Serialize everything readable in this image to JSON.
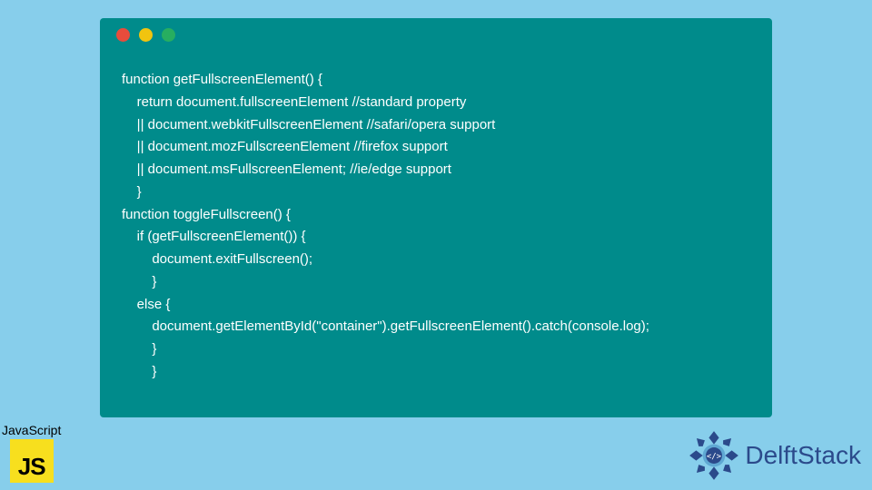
{
  "code": {
    "lines": [
      "function getFullscreenElement() {",
      "    return document.fullscreenElement //standard property",
      "    || document.webkitFullscreenElement //safari/opera support",
      "    || document.mozFullscreenElement //firefox support",
      "    || document.msFullscreenElement; //ie/edge support",
      "    }",
      "function toggleFullscreen() {",
      "    if (getFullscreenElement()) {",
      "        document.exitFullscreen();",
      "        }",
      "    else {",
      "        document.getElementById(\"container\").getFullscreenElement().catch(console.log);",
      "        }",
      "        }"
    ]
  },
  "jsBadge": {
    "label": "JavaScript",
    "iconText": "JS"
  },
  "brand": {
    "name": "DelftStack"
  },
  "colors": {
    "pageBg": "#87ceeb",
    "windowBg": "#008b8b",
    "codeText": "#ffffff",
    "jsYellow": "#f7df1e",
    "brandBlue": "#2b4a8b",
    "dotRed": "#e74c3c",
    "dotYellow": "#f1c40f",
    "dotGreen": "#27ae60"
  }
}
